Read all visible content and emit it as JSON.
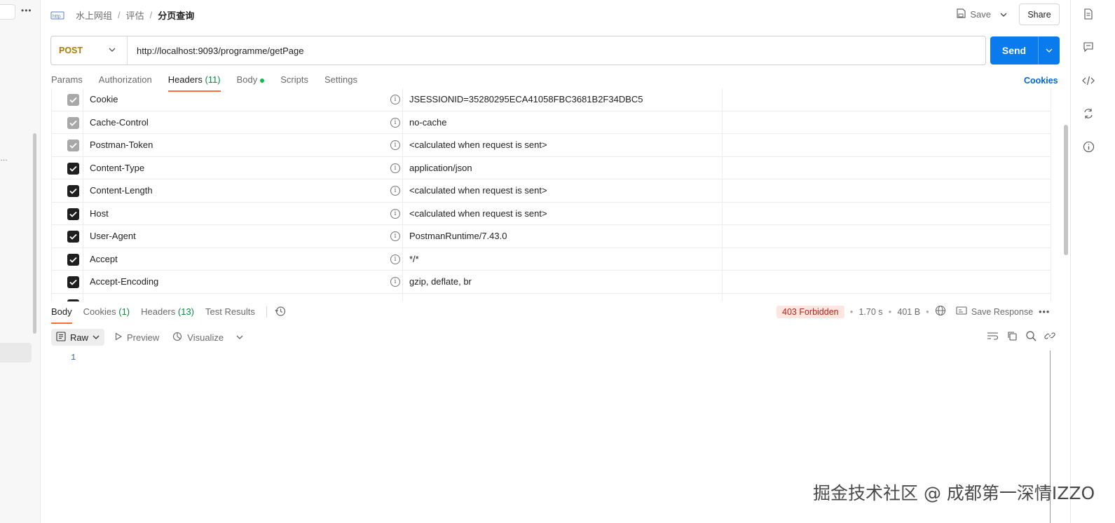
{
  "breadcrumb": {
    "items": [
      "水上网组",
      "评估"
    ],
    "current": "分页查询"
  },
  "header": {
    "save_label": "Save",
    "share_label": "Share"
  },
  "request": {
    "method": "POST",
    "url": "http://localhost:9093/programme/getPage",
    "send_label": "Send"
  },
  "request_tabs": {
    "params": "Params",
    "authorization": "Authorization",
    "headers": "Headers",
    "headers_count": "(11)",
    "body": "Body",
    "scripts": "Scripts",
    "settings": "Settings",
    "cookies": "Cookies"
  },
  "headers_rows": [
    {
      "key": "Cookie",
      "value": "JSESSIONID=35280295ECA41058FBC3681B2F34DBC5",
      "checked": "dim"
    },
    {
      "key": "Cache-Control",
      "value": "no-cache",
      "checked": "dim"
    },
    {
      "key": "Postman-Token",
      "value": "<calculated when request is sent>",
      "checked": "dim"
    },
    {
      "key": "Content-Type",
      "value": "application/json",
      "checked": "on"
    },
    {
      "key": "Content-Length",
      "value": "<calculated when request is sent>",
      "checked": "on"
    },
    {
      "key": "Host",
      "value": "<calculated when request is sent>",
      "checked": "on"
    },
    {
      "key": "User-Agent",
      "value": "PostmanRuntime/7.43.0",
      "checked": "on"
    },
    {
      "key": "Accept",
      "value": "*/*",
      "checked": "on"
    },
    {
      "key": "Accept-Encoding",
      "value": "gzip, deflate, br",
      "checked": "on"
    },
    {
      "key": "",
      "value": "",
      "checked": "on"
    }
  ],
  "response": {
    "tabs": {
      "body": "Body",
      "cookies": "Cookies",
      "cookies_count": "(1)",
      "headers": "Headers",
      "headers_count": "(13)",
      "test_results": "Test Results"
    },
    "status": "403 Forbidden",
    "time": "1.70 s",
    "size": "401 B",
    "save_response": "Save Response",
    "format": "Raw",
    "preview": "Preview",
    "visualize": "Visualize",
    "line_number": "1"
  },
  "watermark": "掘金技术社区 @ 成都第一深情IZZO",
  "colors": {
    "accent": "#ff6c37",
    "send": "#097bed",
    "method": "#ad7a03",
    "status_bg": "#fde6e0"
  }
}
